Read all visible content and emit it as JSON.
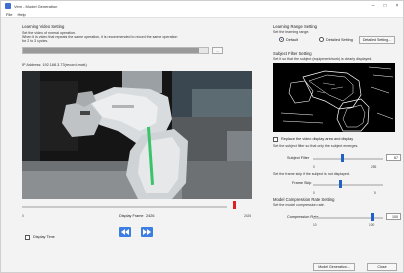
{
  "window": {
    "title": "Vem - Model Generation",
    "menu": [
      "File",
      "Help"
    ]
  },
  "learning_video": {
    "title": "Learning Video Setting",
    "instructions": [
      "Set the video of normal operation.",
      "When it is video that repeats the same operation, it is recommended to record the same operation",
      "for 2 to 3 cycles."
    ],
    "file_progress_label": "",
    "browse_label": "...",
    "ip_address": "IP Address: 192.168.3.73(record.mwk)",
    "frame_label": "Display Frame",
    "frame_value": "2426",
    "frame_slider_min": "0",
    "frame_slider_max": "2426",
    "display_time_label": "Display Time"
  },
  "learning_range": {
    "title": "Learning Range Setting",
    "subtitle": "Set the learning range.",
    "default_label": "Default",
    "detailed_label": "Detailed Setting",
    "detailed_button": "Detailed Setting..."
  },
  "subject_filter": {
    "title": "Subject Filter Setting",
    "instruction": "Set it so that the subject (equipment/work) is clearly displayed.",
    "replace_label": "Replace the video display area and display",
    "filter_instruction": "Set the subject filter so that only the subject emerges.",
    "filter_label": "Subject Filter",
    "filter_value": "67",
    "filter_min": "0",
    "filter_max": "255",
    "frame_skip_instruction": "Set the frame skip if the subject is not displayed.",
    "frame_skip_label": "Frame Skip",
    "frame_skip_min": "0",
    "frame_skip_max": "5"
  },
  "compression": {
    "title": "Model Compression Rate Setting",
    "instruction": "Set the model compression rate.",
    "rate_label": "Compression Rate",
    "rate_value": "100",
    "rate_min": "10",
    "rate_max": "100"
  },
  "footer": {
    "generate_button": "Model Generation...",
    "close_button": "Close"
  },
  "colors": {
    "accent": "#3d7fe0",
    "marker_red": "#e02020"
  }
}
